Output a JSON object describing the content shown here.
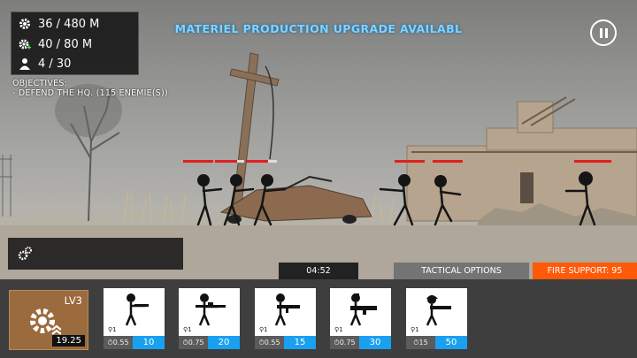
{
  "hud": {
    "supplies": "36 / 480 M",
    "materiel": "40 / 80 M",
    "population": "4 / 30",
    "objectives_title": "OBJECTIVES:",
    "objectives_line": "- DEFEND THE HQ. (115 ENEMIE(S))",
    "banner": "MATERIEL PRODUCTION UPGRADE AVAILABL"
  },
  "controls": {
    "timer": "04:52",
    "tactical": "TACTICAL OPTIONS",
    "fire_support": "FIRE SUPPORT: 95"
  },
  "upgrade": {
    "level": "LV3",
    "cost": "19.25"
  },
  "units": [
    {
      "count": "1",
      "cooldown": "0.55",
      "cost": "10",
      "icon": "rifleman-icon"
    },
    {
      "count": "1",
      "cooldown": "0.75",
      "cost": "20",
      "icon": "sniper-icon"
    },
    {
      "count": "1",
      "cooldown": "0.55",
      "cost": "15",
      "icon": "assault-rifle-icon"
    },
    {
      "count": "1",
      "cooldown": "0.75",
      "cost": "30",
      "icon": "machine-gunner-icon"
    },
    {
      "count": "1",
      "cooldown": "15",
      "cost": "50",
      "icon": "helmet-soldier-icon"
    }
  ],
  "colors": {
    "banner": "#7fd4ff",
    "fire_support": "#ff5a0a",
    "price": "#1aa0f0",
    "upgrade": "#9b6a3d",
    "health_bar": "#e02020"
  }
}
